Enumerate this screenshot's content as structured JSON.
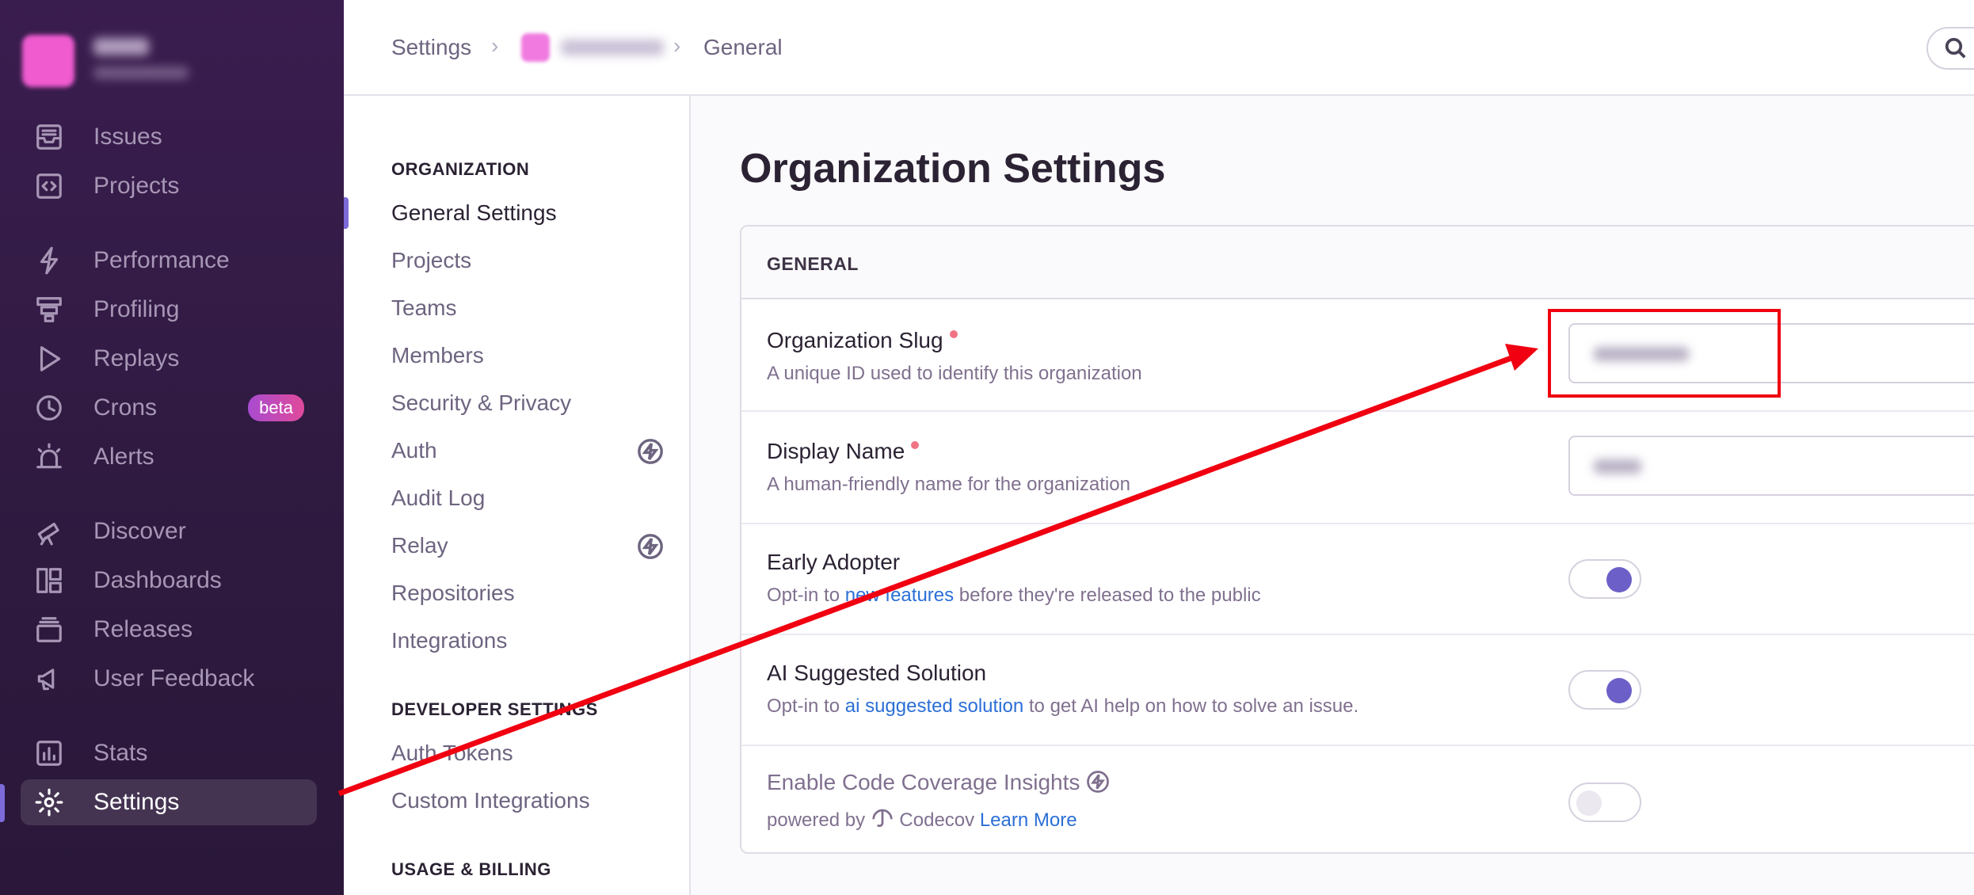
{
  "sidebar": {
    "items": [
      {
        "label": "Issues",
        "icon": "inbox-icon"
      },
      {
        "label": "Projects",
        "icon": "code-folder-icon"
      },
      {
        "label": "Performance",
        "icon": "lightning-icon"
      },
      {
        "label": "Profiling",
        "icon": "profiling-icon"
      },
      {
        "label": "Replays",
        "icon": "play-icon"
      },
      {
        "label": "Crons",
        "icon": "clock-icon",
        "badge": "beta"
      },
      {
        "label": "Alerts",
        "icon": "siren-icon"
      },
      {
        "label": "Discover",
        "icon": "telescope-icon"
      },
      {
        "label": "Dashboards",
        "icon": "dashboard-icon"
      },
      {
        "label": "Releases",
        "icon": "stack-icon"
      },
      {
        "label": "User Feedback",
        "icon": "megaphone-icon"
      },
      {
        "label": "Stats",
        "icon": "bar-chart-icon"
      },
      {
        "label": "Settings",
        "icon": "gear-icon",
        "active": true
      }
    ]
  },
  "breadcrumb": {
    "root": "Settings",
    "current": "General"
  },
  "settings_nav": {
    "sections": [
      {
        "heading": "ORGANIZATION",
        "items": [
          "General Settings",
          "Projects",
          "Teams",
          "Members",
          "Security & Privacy",
          "Auth",
          "Audit Log",
          "Relay",
          "Repositories",
          "Integrations"
        ]
      },
      {
        "heading": "DEVELOPER SETTINGS",
        "items": [
          "Auth Tokens",
          "Custom Integrations"
        ]
      },
      {
        "heading": "USAGE & BILLING",
        "items": []
      }
    ],
    "active": "General Settings"
  },
  "main": {
    "title": "Organization Settings",
    "panel_title": "GENERAL",
    "fields": {
      "slug": {
        "label": "Organization Slug",
        "help": "A unique ID used to identify this organization"
      },
      "display_name": {
        "label": "Display Name",
        "help": "A human-friendly name for the organization"
      },
      "early_adopter": {
        "label": "Early Adopter",
        "help_prefix": "Opt-in to ",
        "help_link": "new features",
        "help_suffix": " before they're released to the public",
        "enabled": true
      },
      "ai_solution": {
        "label": "AI Suggested Solution",
        "help_prefix": "Opt-in to ",
        "help_link": "ai suggested solution",
        "help_suffix": " to get AI help on how to solve an issue.",
        "enabled": true
      },
      "code_coverage": {
        "label": "Enable Code Coverage Insights",
        "powered_by": "powered by",
        "brand": "Codecov",
        "learn_more": "Learn More",
        "enabled": false
      }
    }
  },
  "colors": {
    "sidebar_bg": "#3a1d4f",
    "accent": "#6c5fc7",
    "annotation": "#f00010",
    "link": "#2b6fd6"
  }
}
